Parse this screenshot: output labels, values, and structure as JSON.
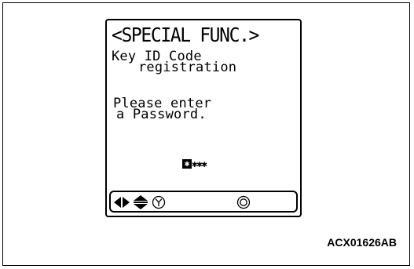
{
  "screen": {
    "title": "<SPECIAL FUNC.>",
    "line1": "Key ID Code",
    "line2": "registration",
    "line3": "Please enter",
    "line4": "a Password.",
    "password_cursor": "✱",
    "password_rest": "✱✱✱"
  },
  "softkeys": [
    {
      "icon": "left-right-arrows-icon"
    },
    {
      "icon": "up-down-arrows-icon"
    },
    {
      "icon": "yes-circle-icon"
    },
    {
      "icon": "no-circle-icon"
    }
  ],
  "caption": "ACX01626AB"
}
